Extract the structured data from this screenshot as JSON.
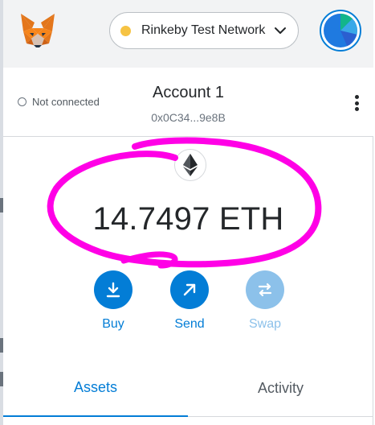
{
  "header": {
    "logo_icon": "metamask-fox-icon",
    "network": {
      "label": "Rinkeby Test Network",
      "dot_color": "#f6c343",
      "chevron_icon": "chevron-down-icon"
    },
    "avatar_icon": "account-identicon"
  },
  "account": {
    "connection_status": "Not connected",
    "name": "Account 1",
    "address": "0x0C34...9e8B",
    "menu_icon": "kebab-menu-icon"
  },
  "balance": {
    "token_icon": "ethereum-icon",
    "amount": "14.7497",
    "unit": "ETH"
  },
  "actions": [
    {
      "label": "Buy",
      "icon": "download-icon",
      "enabled": true
    },
    {
      "label": "Send",
      "icon": "arrow-up-right-icon",
      "enabled": true
    },
    {
      "label": "Swap",
      "icon": "swap-arrows-icon",
      "enabled": false
    }
  ],
  "tabs": [
    {
      "label": "Assets",
      "active": true
    },
    {
      "label": "Activity",
      "active": false
    }
  ],
  "colors": {
    "accent": "#037dd6",
    "disabled": "#8cc1ea",
    "annotation": "#ff00e6"
  }
}
